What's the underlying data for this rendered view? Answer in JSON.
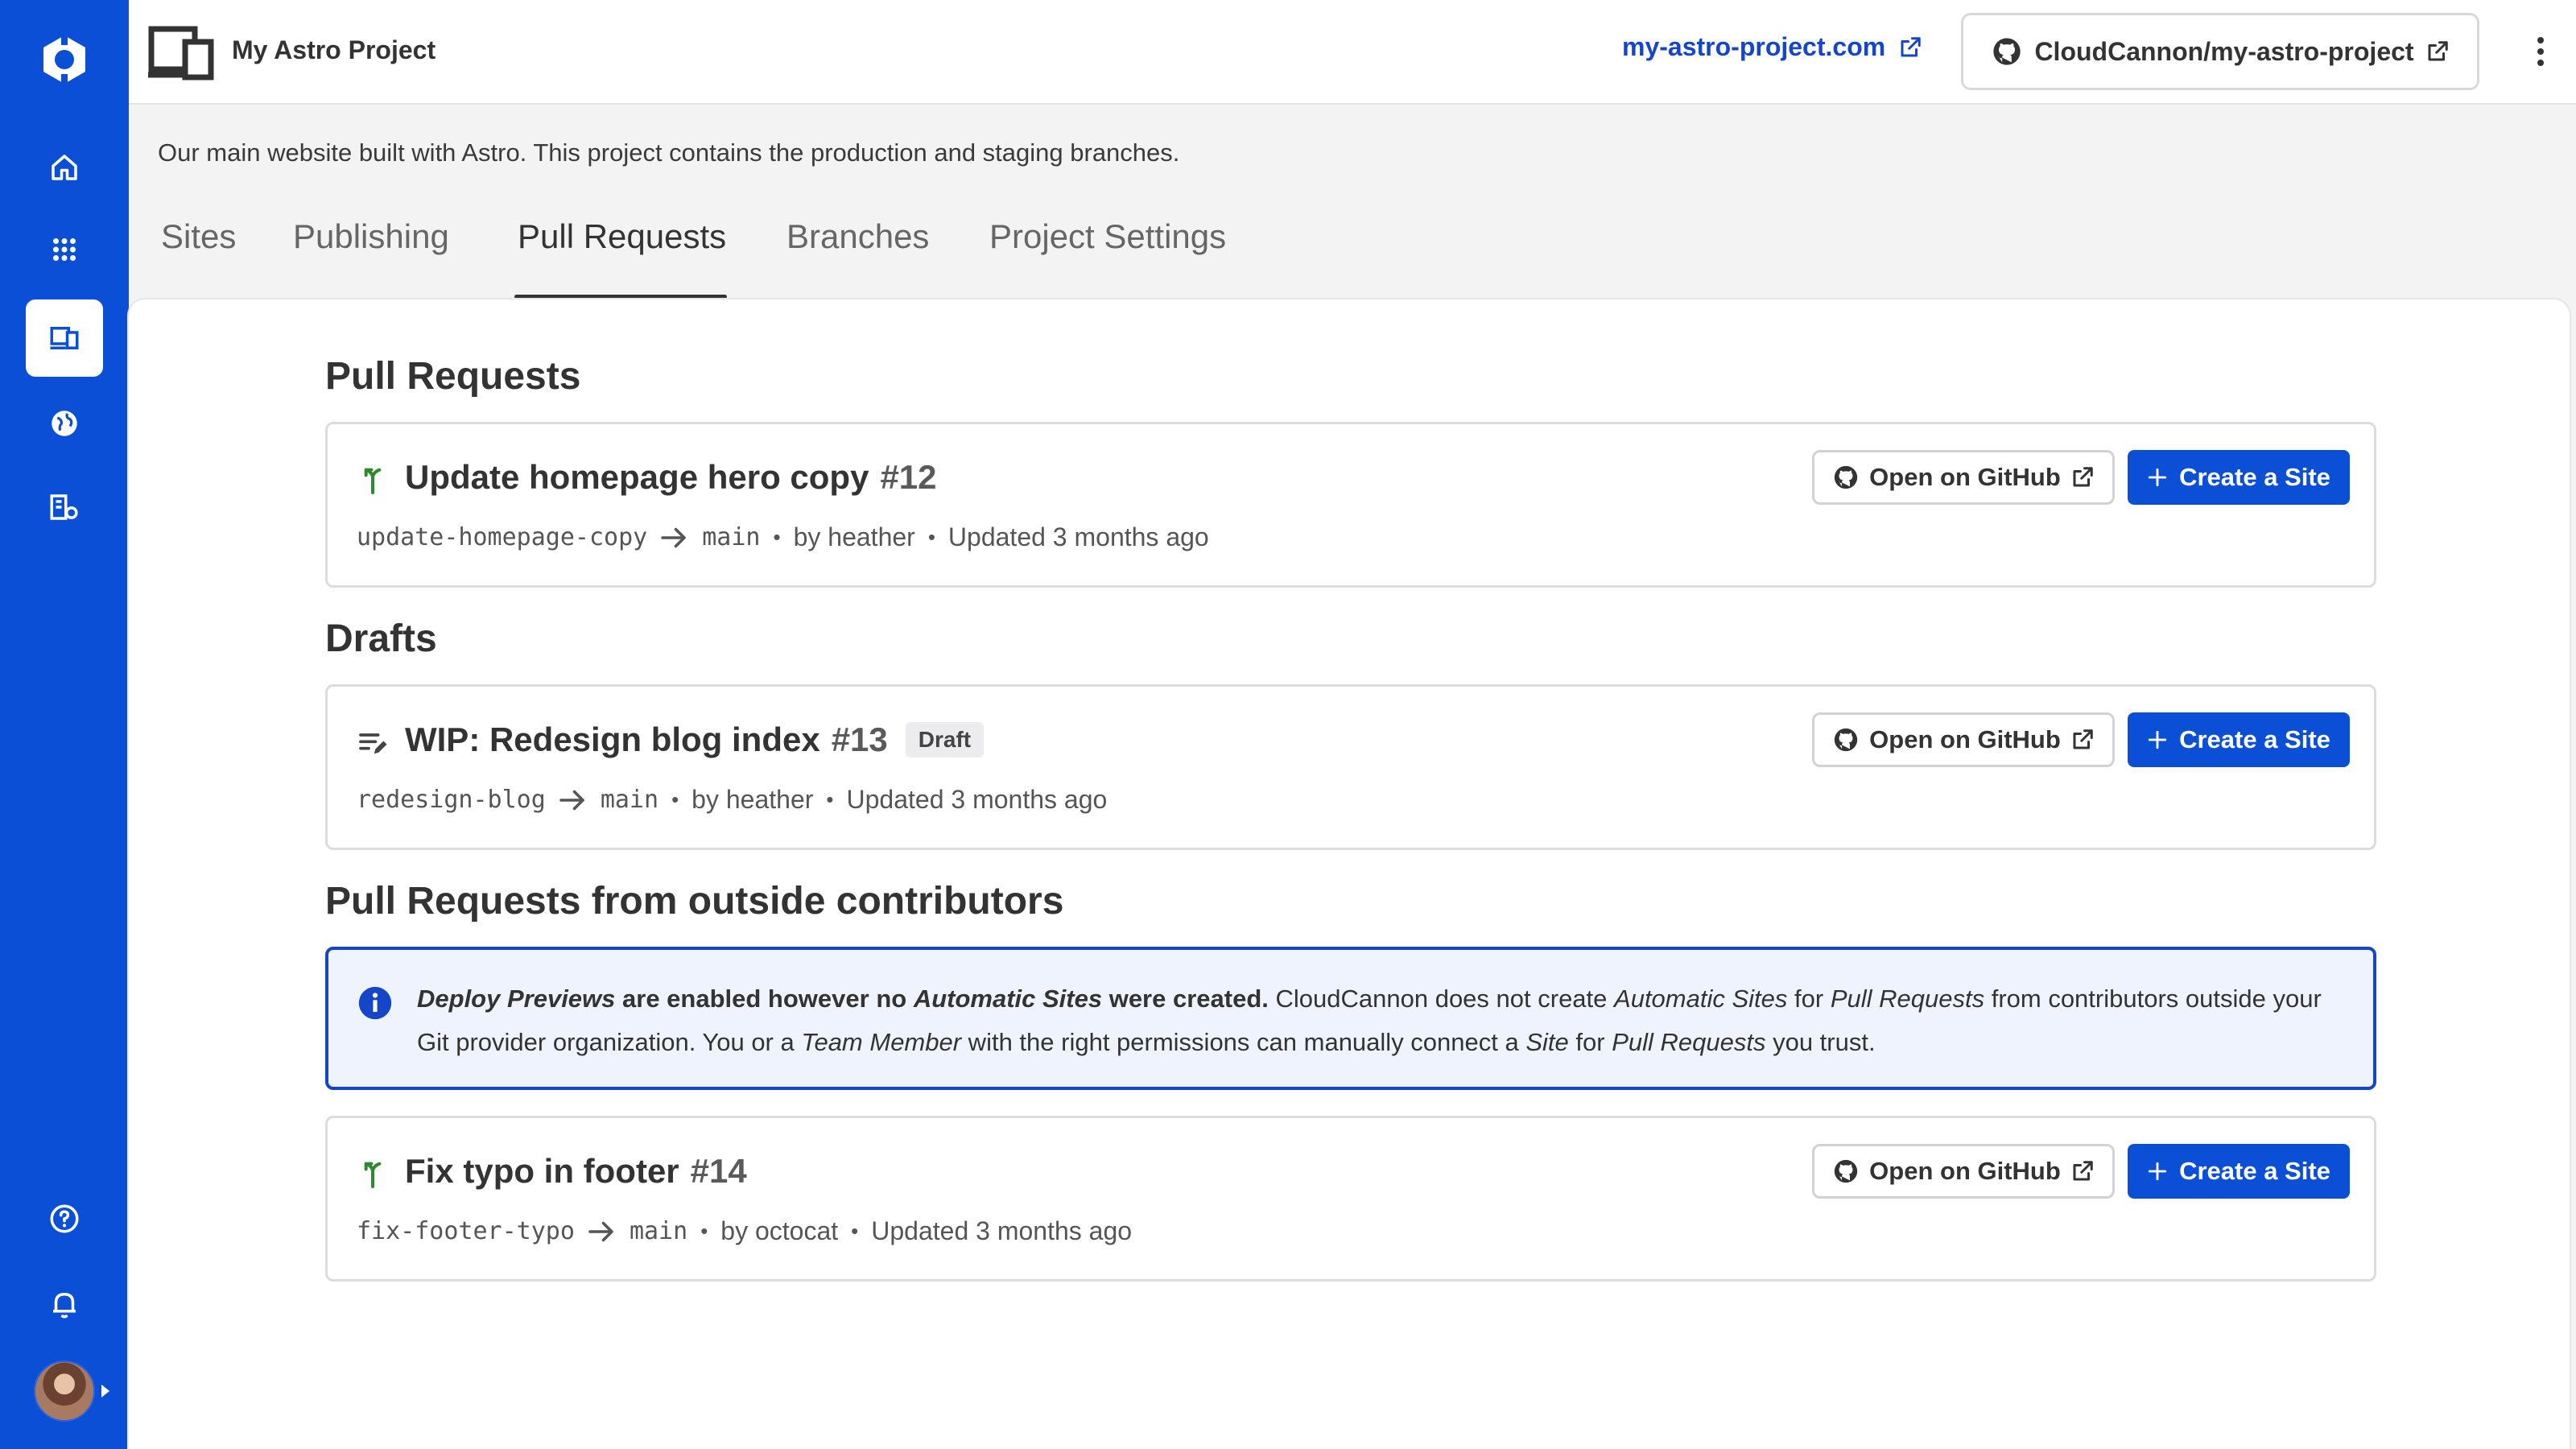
{
  "header": {
    "project_title": "My Astro Project",
    "site_link": "my-astro-project.com",
    "repo_label": "CloudCannon/my-astro-project"
  },
  "description": "Our main website built with Astro. This project contains the production and staging branches.",
  "tabs": [
    {
      "label": "Sites"
    },
    {
      "label": "Publishing"
    },
    {
      "label": "Pull Requests",
      "active": true
    },
    {
      "label": "Branches"
    },
    {
      "label": "Project Settings"
    }
  ],
  "sections": {
    "pull_requests": "Pull Requests",
    "drafts": "Drafts",
    "outside": "Pull Requests from outside contributors"
  },
  "cards": [
    {
      "title": "Update homepage hero copy",
      "number": "#12",
      "source_branch": "update-homepage-copy",
      "target_branch": "main",
      "author": "by heather",
      "updated": "Updated 3 months ago",
      "icon": "pull-request-icon"
    },
    {
      "title": "WIP: Redesign blog index",
      "number": "#13",
      "badge": "Draft",
      "source_branch": "redesign-blog",
      "target_branch": "main",
      "author": "by heather",
      "updated": "Updated 3 months ago",
      "icon": "draft-icon"
    },
    {
      "title": "Fix typo in footer",
      "number": "#14",
      "source_branch": "fix-footer-typo",
      "target_branch": "main",
      "author": "by octocat",
      "updated": "Updated 3 months ago",
      "icon": "pull-request-icon"
    }
  ],
  "buttons": {
    "open_github": "Open on GitHub",
    "create_site": "Create a Site"
  },
  "notice": {
    "b1": "Deploy Previews",
    "t1": " are enabled however no ",
    "b2": "Automatic Sites",
    "t2": " were created.",
    "t3": " CloudCannon does not create ",
    "i1": "Automatic Sites",
    "t4": " for ",
    "i2": "Pull Requests",
    "t5": " from contributors outside your Git provider organization. You or a ",
    "i3": "Team Member",
    "t6": " with the right permissions can manually connect a ",
    "i4": "Site",
    "t7": " for ",
    "i5": "Pull Requests",
    "t8": " you trust."
  },
  "colors": {
    "brand": "#0b4fd6",
    "link": "#1546c8",
    "pr_green": "#2f8a2f"
  }
}
